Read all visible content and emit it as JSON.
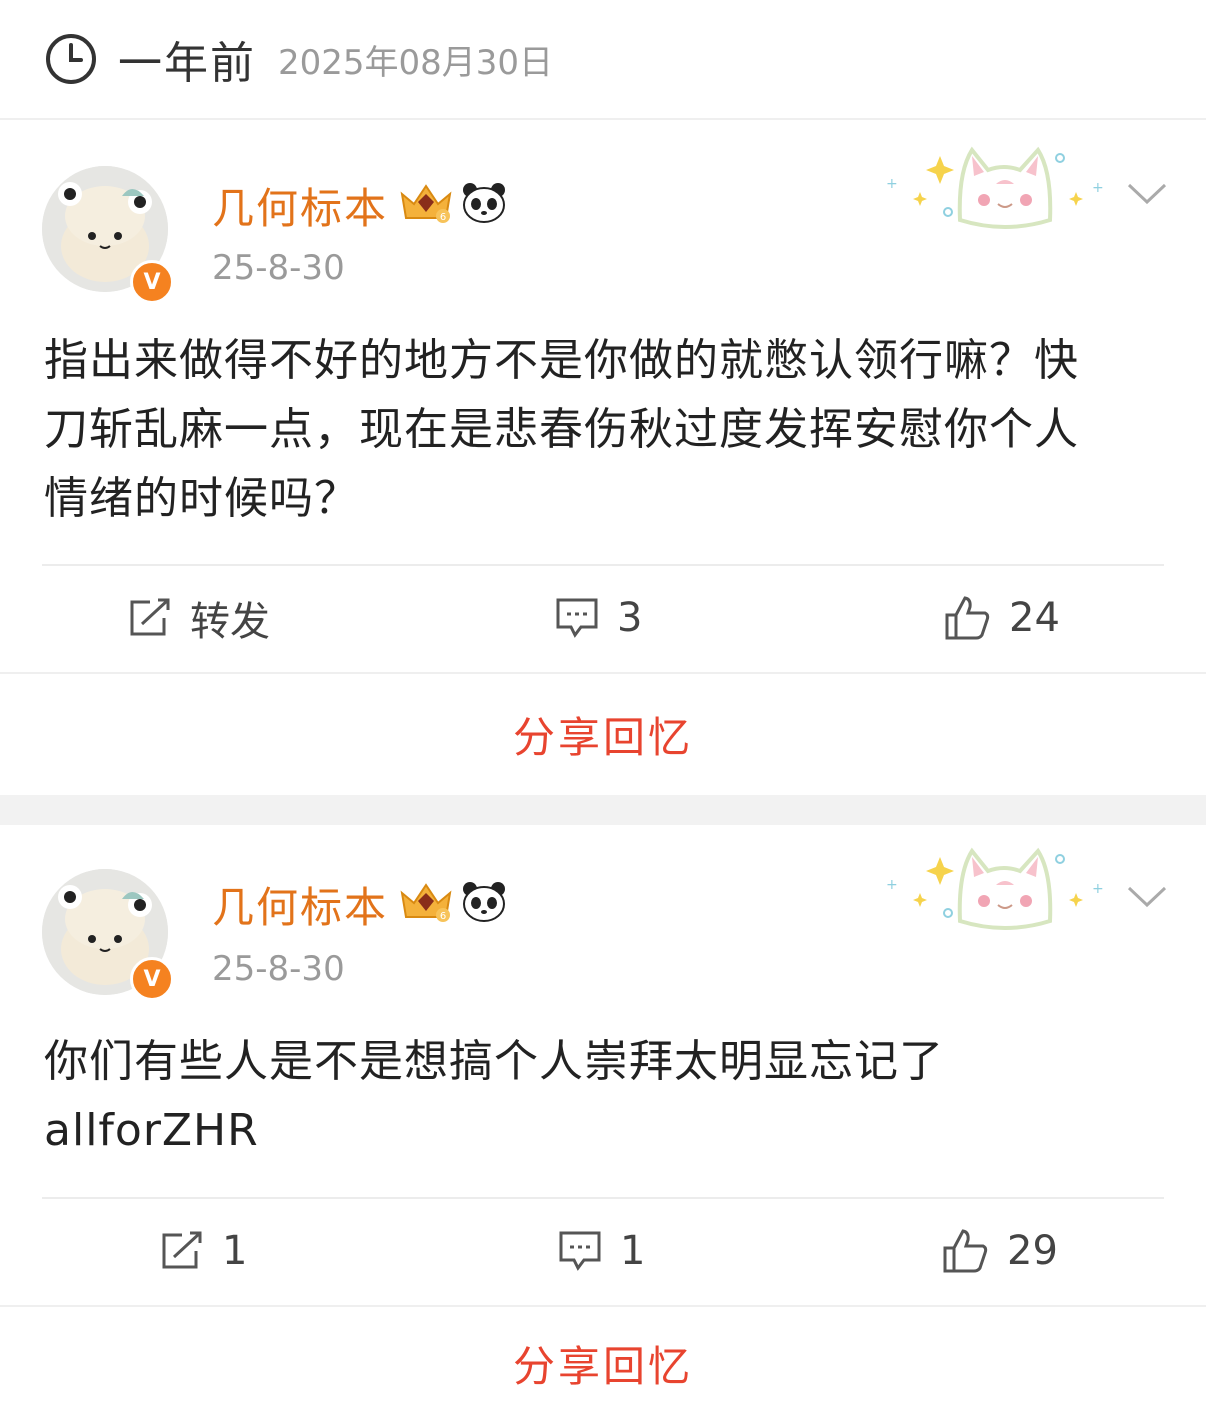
{
  "header": {
    "relative": "一年前",
    "date": "2025年08月30日"
  },
  "posts": [
    {
      "username": "几何标本",
      "time": "25-8-30",
      "verified_mark": "V",
      "level_badge": "6",
      "text_lines": [
        "指出来做得不好的地方不是你做的就憋认领行嘛？快",
        "刀斩乱麻一点，现在是悲春伤秋过度发挥安慰你个人",
        "情绪的时候吗？"
      ],
      "repost": "转发",
      "comments": "3",
      "likes": "24",
      "share": "分享回忆"
    },
    {
      "username": "几何标本",
      "time": "25-8-30",
      "verified_mark": "V",
      "level_badge": "6",
      "text_lines": [
        "你们有些人是不是想搞个人崇拜太明显忘记了",
        "allforZHR"
      ],
      "repost": "1",
      "comments": "1",
      "likes": "29",
      "share": "分享回忆"
    }
  ],
  "colors": {
    "username": "#e2731a",
    "share": "#e8442f",
    "verified": "#f58220",
    "meta": "#9a9a9a"
  },
  "icons": [
    "clock-icon",
    "crown-icon",
    "panda-icon",
    "cat-sticker-icon",
    "chevron-down-icon",
    "repost-icon",
    "comment-icon",
    "like-icon"
  ]
}
